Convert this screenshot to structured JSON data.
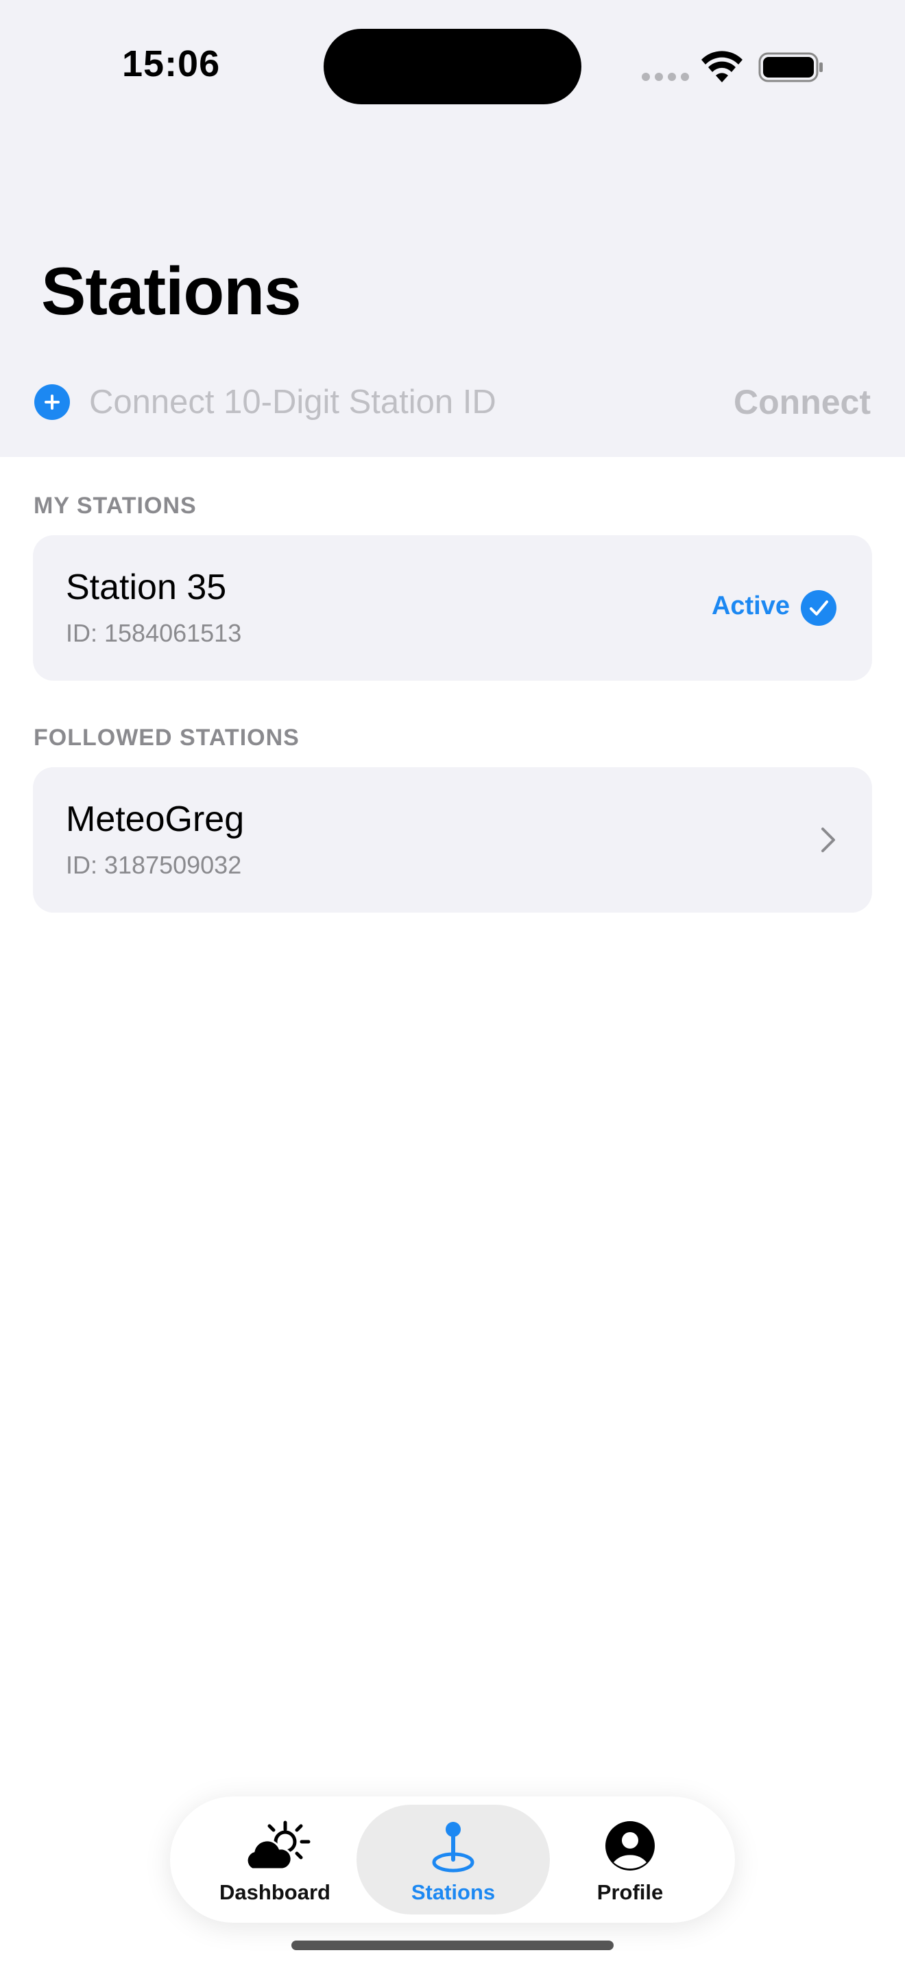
{
  "status_bar": {
    "time": "15:06"
  },
  "header": {
    "title": "Stations",
    "connect_placeholder": "Connect 10-Digit Station ID",
    "connect_label": "Connect"
  },
  "my_stations": {
    "header": "MY STATIONS",
    "items": [
      {
        "name": "Station 35",
        "id": "ID: 1584061513",
        "status": "Active"
      }
    ]
  },
  "followed_stations": {
    "header": "FOLLOWED STATIONS",
    "items": [
      {
        "name": "MeteoGreg",
        "id": "ID: 3187509032"
      }
    ]
  },
  "tab_bar": {
    "tabs": [
      {
        "label": "Dashboard",
        "icon": "cloud-sun-icon"
      },
      {
        "label": "Stations",
        "icon": "map-pin-icon",
        "selected": true
      },
      {
        "label": "Profile",
        "icon": "person-circle-icon"
      }
    ]
  },
  "colors": {
    "accent": "#1c88f2",
    "background_grouped": "#f2f2f7",
    "secondary_text": "#8a8a8e"
  }
}
